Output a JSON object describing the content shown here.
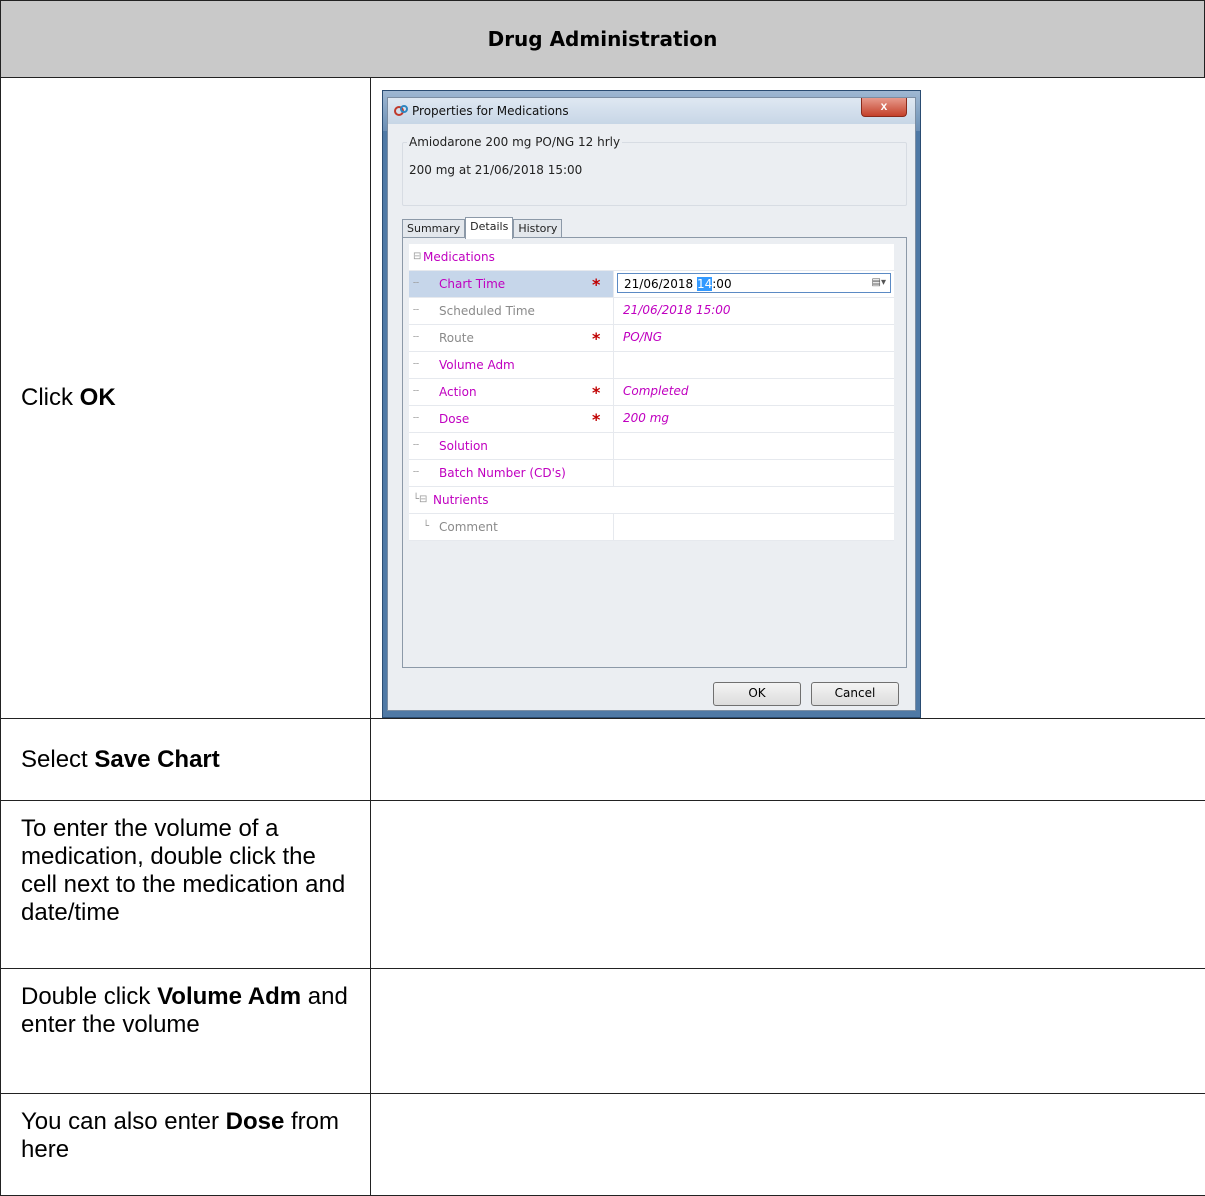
{
  "header": {
    "title": "Drug Administration"
  },
  "steps": [
    {
      "pre": "Click ",
      "bold": "OK",
      "post": ""
    },
    {
      "pre": "Select ",
      "bold": "Save Chart",
      "post": ""
    },
    {
      "pre": "To enter the volume of a medication, double click the cell next to the medication and date/time",
      "bold": "",
      "post": ""
    },
    {
      "pre": "Double click ",
      "bold": "Volume Adm",
      "post": " and enter the volume"
    },
    {
      "pre": "You can also enter ",
      "bold": "Dose",
      "post": " from here"
    }
  ],
  "dialog": {
    "title": "Properties for Medications",
    "close_label": "x",
    "order_title": "Amiodarone 200 mg PO/NG 12 hrly",
    "order_detail": "200 mg at 21/06/2018 15:00",
    "tabs": [
      "Summary",
      "Details",
      "History"
    ],
    "active_tab": "Details",
    "grid": {
      "group_label": "Medications",
      "rows": [
        {
          "label": "Chart Time",
          "required": "*",
          "value_prefix": "21/06/2018 ",
          "value_highlight": "14",
          "value_suffix": ":00",
          "selected": true
        },
        {
          "label": "Scheduled Time",
          "required": "",
          "value": "21/06/2018 15:00"
        },
        {
          "label": "Route",
          "required": "*",
          "value": "PO/NG"
        },
        {
          "label": "Volume Adm",
          "required": "",
          "value": ""
        },
        {
          "label": "Action",
          "required": "*",
          "value": "Completed"
        },
        {
          "label": "Dose",
          "required": "*",
          "value": "200 mg"
        },
        {
          "label": "Solution",
          "required": "",
          "value": ""
        },
        {
          "label": "Batch Number (CD's)",
          "required": "",
          "value": ""
        }
      ],
      "subgroup_label": "Nutrients",
      "sub_rows": [
        {
          "label": "Comment",
          "value": ""
        }
      ]
    },
    "ok_label": "OK",
    "cancel_label": "Cancel"
  }
}
